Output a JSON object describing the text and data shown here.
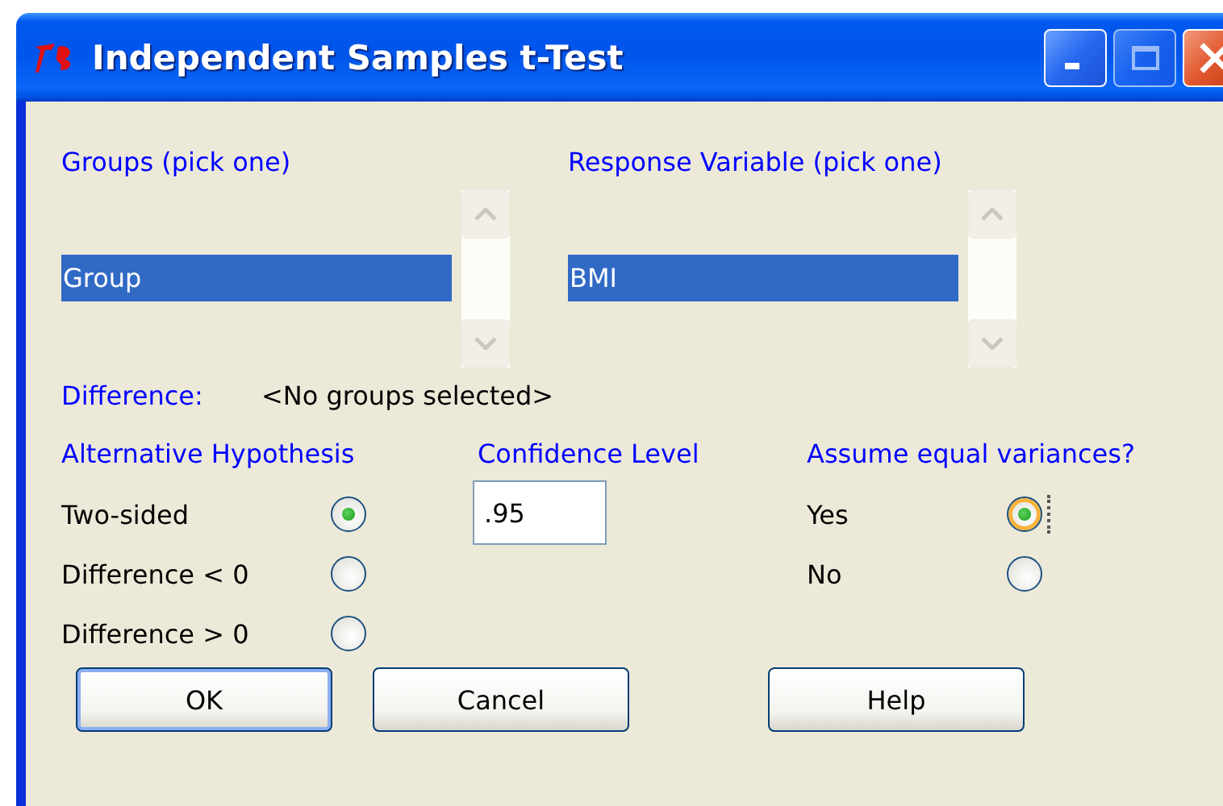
{
  "window": {
    "title": "Independent Samples t-Test"
  },
  "lists": [
    {
      "label": "Groups (pick one)",
      "items": [
        {
          "text": "Group",
          "selected": true
        }
      ]
    },
    {
      "label": "Response Variable (pick one)",
      "items": [
        {
          "text": "BMI",
          "selected": true
        }
      ]
    }
  ],
  "difference": {
    "label": "Difference:",
    "value": "<No groups selected>"
  },
  "alternative": {
    "label": "Alternative Hypothesis",
    "options": [
      {
        "text": "Two-sided",
        "selected": true
      },
      {
        "text": "Difference < 0",
        "selected": false
      },
      {
        "text": "Difference > 0",
        "selected": false
      }
    ]
  },
  "confidence": {
    "label": "Confidence Level",
    "value": ".95"
  },
  "equal_variances": {
    "label": "Assume equal variances?",
    "options": [
      {
        "text": "Yes",
        "selected": true,
        "focused": true
      },
      {
        "text": "No",
        "selected": false,
        "focused": false
      }
    ]
  },
  "buttons": [
    {
      "label": "OK",
      "default": true
    },
    {
      "label": "Cancel",
      "default": false
    },
    {
      "label": "Help",
      "default": false
    }
  ]
}
